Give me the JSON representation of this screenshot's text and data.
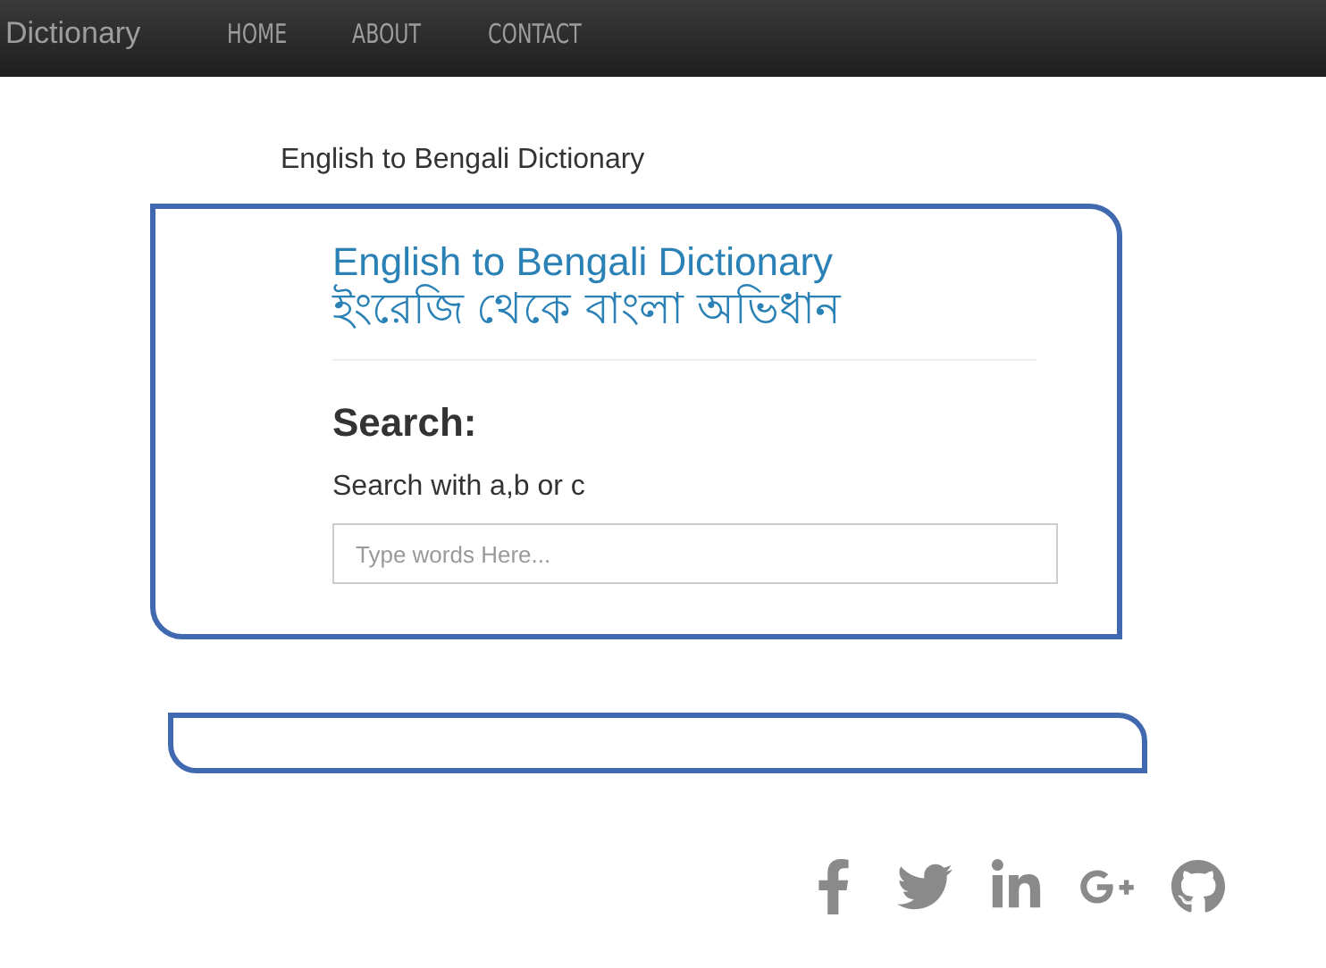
{
  "navbar": {
    "brand": "Dictionary",
    "links": [
      "HOME",
      "ABOUT",
      "CONTACT"
    ]
  },
  "page_title": "English to Bengali Dictionary",
  "search_card": {
    "heading": "English to Bengali Dictionary",
    "heading_bengali": "ইংরেজি থেকে বাংলা অভিধান",
    "search_label": "Search:",
    "hint": "Search with a,b or c",
    "search_field": {
      "placeholder": "Type words Here..."
    }
  }
}
